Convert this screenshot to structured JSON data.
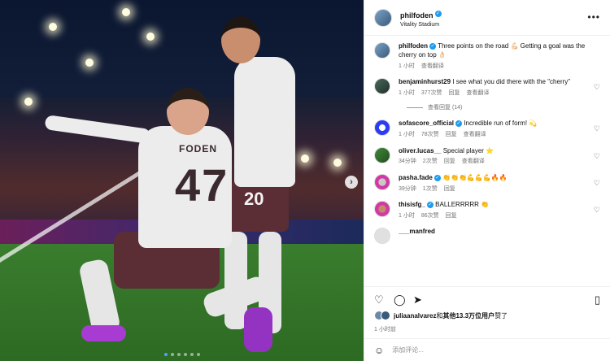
{
  "post": {
    "username": "philfoden",
    "location": "Vitality Stadium",
    "caption_text": "Three points on the road 💪🏻 Getting a goal was the cherry on top 👌🏻",
    "caption_time": "1 小时",
    "caption_translate": "查看翻译"
  },
  "comments": [
    {
      "user": "benjaminhurst29",
      "text": "I see what you did there with the \"cherry\"",
      "time": "1 小时",
      "likes": "377次赞",
      "reply": "回复",
      "translate": "查看翻译"
    },
    {
      "user": "sofascore_official",
      "text": "Incredible run of form! 💫",
      "time": "1 小时",
      "likes": "78次赞",
      "reply": "回复",
      "translate": "查看翻译"
    },
    {
      "user": "oliver.lucas__",
      "text": "Special player ⭐",
      "time": "34分钟",
      "likes": "2次赞",
      "reply": "回复",
      "translate": "查看翻译"
    },
    {
      "user": "pasha.fade",
      "text": "👏👏👏💪💪💪🔥🔥",
      "time": "39分钟",
      "likes": "1次赞",
      "reply": "回复",
      "translate": ""
    },
    {
      "user": "thisisfg_",
      "text": "BALLERRRRR 👏",
      "time": "1 小时",
      "likes": "86次赞",
      "reply": "回复",
      "translate": ""
    },
    {
      "user": "___manfred",
      "text": "",
      "time": "",
      "likes": "",
      "reply": "",
      "translate": ""
    }
  ],
  "replies_label": "查看回复 (14)",
  "likes_line": {
    "user": "juliaanalvarez",
    "middle": "和",
    "bold": "其他13.3万位用户",
    "end": "赞了"
  },
  "post_time": "1 小时前",
  "add_comment_placeholder": "添加评论...",
  "jersey": {
    "name": "FODEN",
    "number_front": "47",
    "number_back": "20"
  },
  "icons": [
    "heart-icon",
    "comment-icon",
    "share-icon",
    "bookmark-icon",
    "more-icon",
    "smile-icon",
    "next-arrow-icon"
  ],
  "colors": {
    "accent": "#1d9bf0",
    "muted": "#737373"
  }
}
